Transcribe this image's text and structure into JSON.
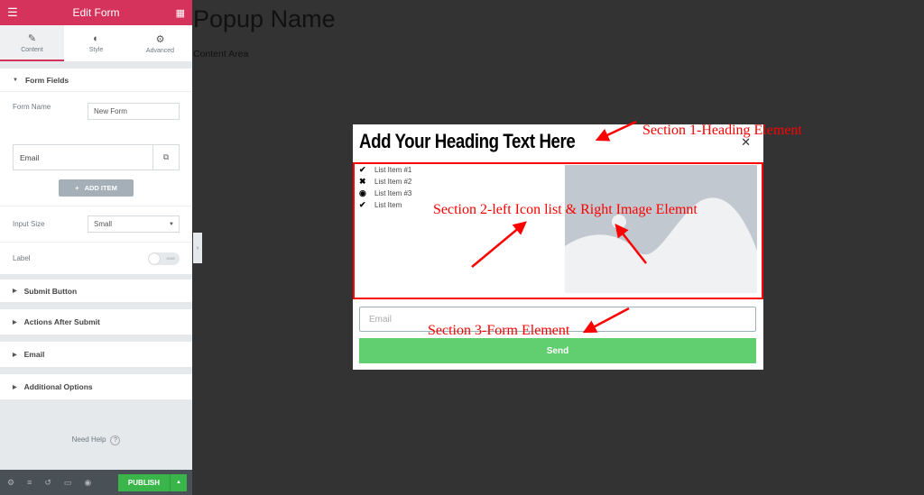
{
  "sidebar": {
    "title": "Edit Form",
    "tabs": [
      {
        "label": "Content",
        "icon": "pencil-icon"
      },
      {
        "label": "Style",
        "icon": "half-circle-icon"
      },
      {
        "label": "Advanced",
        "icon": "gear-icon"
      }
    ],
    "form_fields": {
      "title": "Form Fields",
      "form_name_label": "Form Name",
      "form_name_value": "New Form",
      "field_item": "Email",
      "add_item": "ADD ITEM",
      "input_size_label": "Input Size",
      "input_size_value": "Small",
      "label_label": "Label",
      "label_toggle": "HIDE"
    },
    "sections": [
      "Submit Button",
      "Actions After Submit",
      "Email",
      "Additional Options"
    ],
    "need_help": "Need Help",
    "publish": "PUBLISH"
  },
  "canvas": {
    "title": "Popup Name",
    "content": "Content Area"
  },
  "popup": {
    "heading": "Add Your Heading Text Here",
    "list": [
      {
        "icon": "check-icon",
        "text": "List Item #1"
      },
      {
        "icon": "times-icon",
        "text": "List Item #2"
      },
      {
        "icon": "dot-circle-icon",
        "text": "List Item #3"
      },
      {
        "icon": "check-icon",
        "text": "List Item"
      }
    ],
    "email_placeholder": "Email",
    "send": "Send",
    "send_color": "#61ce70"
  },
  "annotations": {
    "s1": "Section 1-Heading Element",
    "s2": "Section 2-left Icon list & Right Image Elemnt",
    "s3": "Section 3-Form Element",
    "color": "#ff0000"
  }
}
